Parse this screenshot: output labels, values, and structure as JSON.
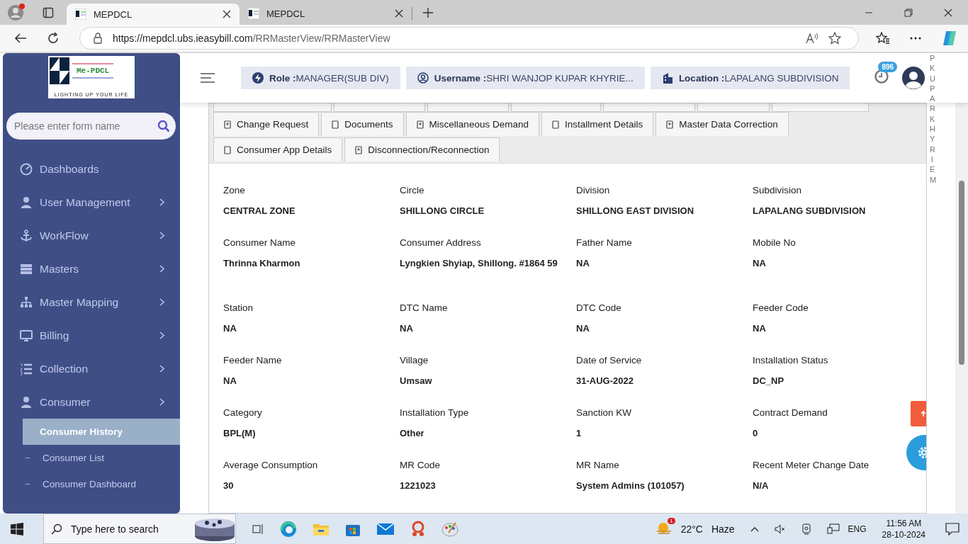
{
  "browser": {
    "tabs": [
      {
        "title": "MEPDCL",
        "selected": true
      },
      {
        "title": "MEPDCL",
        "selected": false
      }
    ],
    "url_host": "https://mepdcl.ubs.ieasybill.com",
    "url_path": "/RRMasterView/RRMasterView"
  },
  "sidebar": {
    "logo_title": "Me-PDCL",
    "logo_tagline": "LIGHTING UP YOUR LIFE",
    "search": {
      "placeholder": "Please enter form name"
    },
    "items": [
      {
        "label": "Dashboards",
        "expandable": false
      },
      {
        "label": "User Management",
        "expandable": true
      },
      {
        "label": "WorkFlow",
        "expandable": true
      },
      {
        "label": "Masters",
        "expandable": true
      },
      {
        "label": "Master Mapping",
        "expandable": true
      },
      {
        "label": "Billing",
        "expandable": true
      },
      {
        "label": "Collection",
        "expandable": true
      },
      {
        "label": "Consumer",
        "expandable": true,
        "children": [
          {
            "label": "Consumer History",
            "selected": true
          },
          {
            "label": "Consumer List",
            "selected": false
          },
          {
            "label": "Consumer Dashboard",
            "selected": false
          }
        ]
      }
    ]
  },
  "header": {
    "chips": [
      {
        "key": "Role :",
        "value": "MANAGER(SUB DIV)"
      },
      {
        "key": "Username :",
        "value": "SHRI WANJOP KUPAR KHYRIE..."
      },
      {
        "key": "Location :",
        "value": "LAPALANG SUBDIVISION"
      }
    ],
    "notification_count": "896",
    "vertical_name": "PKUPARKHYRIEM"
  },
  "tabs": [
    {
      "label": "Change Request",
      "selected": false
    },
    {
      "label": "Documents",
      "selected": false
    },
    {
      "label": "Miscellaneous Demand",
      "selected": false
    },
    {
      "label": "Installment Details",
      "selected": false
    },
    {
      "label": "Master Data Correction",
      "selected": false
    },
    {
      "label": "Consumer App Details",
      "selected": false
    },
    {
      "label": "Disconnection/Reconnection",
      "selected": false
    }
  ],
  "fields": [
    {
      "label": "Zone",
      "value": "CENTRAL ZONE"
    },
    {
      "label": "Circle",
      "value": "SHILLONG CIRCLE"
    },
    {
      "label": "Division",
      "value": "SHILLONG EAST DIVISION"
    },
    {
      "label": "Subdivision",
      "value": "LAPALANG SUBDIVISION"
    },
    {
      "label": "Consumer Name",
      "value": "Thrinna Kharmon"
    },
    {
      "label": "Consumer Address",
      "value": "Lyngkien Shyiap, Shillong. #1864 59"
    },
    {
      "label": "Father Name",
      "value": "NA"
    },
    {
      "label": "Mobile No",
      "value": "NA"
    },
    {
      "label": "Station",
      "value": "NA"
    },
    {
      "label": "DTC Name",
      "value": "NA"
    },
    {
      "label": "DTC Code",
      "value": "NA"
    },
    {
      "label": "Feeder Code",
      "value": "NA"
    },
    {
      "label": "Feeder Name",
      "value": "NA"
    },
    {
      "label": "Village",
      "value": "Umsaw"
    },
    {
      "label": "Date of Service",
      "value": "31-AUG-2022"
    },
    {
      "label": "Installation Status",
      "value": "DC_NP"
    },
    {
      "label": "Category",
      "value": "BPL(M)"
    },
    {
      "label": "Installation Type",
      "value": "Other"
    },
    {
      "label": "Sanction KW",
      "value": "1"
    },
    {
      "label": "Contract Demand",
      "value": "0"
    },
    {
      "label": "Average Consumption",
      "value": "30"
    },
    {
      "label": "MR Code",
      "value": "1221023"
    },
    {
      "label": "MR Name",
      "value": "System Admins (101057)"
    },
    {
      "label": "Recent Meter Change Date",
      "value": "N/A"
    }
  ],
  "taskbar": {
    "search_placeholder": "Type here to search",
    "temperature": "22°C",
    "weather": "Haze",
    "weather_badge": "1",
    "language": "ENG",
    "time": "11:56 AM",
    "date": "28-10-2024"
  }
}
